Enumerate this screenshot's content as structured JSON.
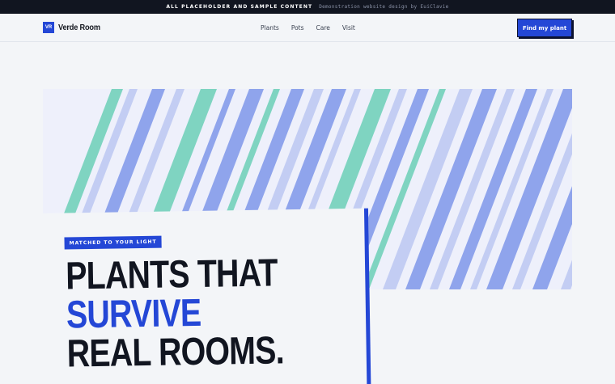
{
  "announcement": {
    "label": "ALL PLACEHOLDER AND SAMPLE CONTENT",
    "note": "Demonstration website design by EuiClavie"
  },
  "header": {
    "logo_badge": "VR",
    "brand": "Verde Room",
    "nav": [
      {
        "label": "Plants"
      },
      {
        "label": "Pots"
      },
      {
        "label": "Care"
      },
      {
        "label": "Visit"
      }
    ],
    "cta_label": "Find my plant"
  },
  "hero": {
    "tag": "MATCHED TO YOUR LIGHT",
    "headline_line1": "PLANTS THAT",
    "headline_line2": "SURVIVE",
    "headline_line3": "REAL ROOMS."
  },
  "colors": {
    "accent": "#2447d6",
    "dark": "#111520",
    "stripe_mint": "#7fd4c1",
    "stripe_blue": "#8fa4ec",
    "stripe_light": "#c3cdf3"
  }
}
